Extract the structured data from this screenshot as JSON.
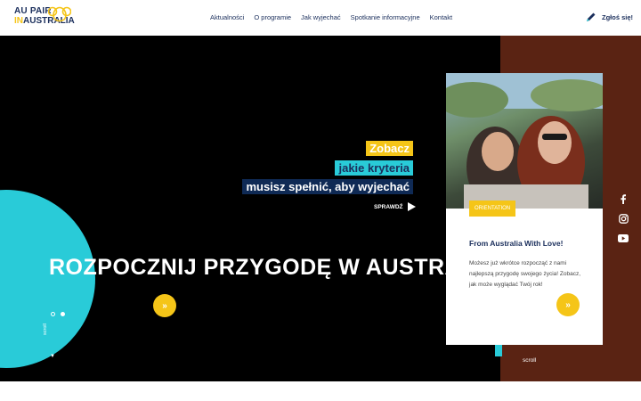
{
  "logo": {
    "line1": "AU PAIR",
    "line2_in": "IN",
    "line2_rest": "AUSTRALIA"
  },
  "nav": {
    "items": [
      "Aktualności",
      "O programie",
      "Jak wyjechać",
      "Spotkanie informacyjne",
      "Kontakt"
    ]
  },
  "signup": {
    "label": "Zgłoś się!"
  },
  "hero": {
    "headline1": "Zobacz",
    "headline2": "jakie kryteria",
    "headline3": "musisz spełnić, aby wyjechać",
    "cta_label": "SPRAWDŹ",
    "big_title": "ROZPOCZNIJ PRZYGODĘ W AUSTRALII",
    "arrow": "»",
    "scroll_left": "scroll",
    "scroll_right": "scroll",
    "slides_total": 2,
    "slide_active": 2
  },
  "card": {
    "tag": "ORIENTATION",
    "title": "From Australia With Love!",
    "text": "Możesz już wkrótce rozpocząć z nami najlepszą przygodę swojego życia! Zobacz, jak może wyglądać Twój rok!",
    "arrow": "»"
  },
  "socials": [
    "facebook-icon",
    "instagram-icon",
    "youtube-icon"
  ],
  "colors": {
    "yellow": "#f5c518",
    "cyan": "#29cbd8",
    "navy": "#1b2f5c",
    "brown": "#5a2313",
    "black": "#000000"
  }
}
